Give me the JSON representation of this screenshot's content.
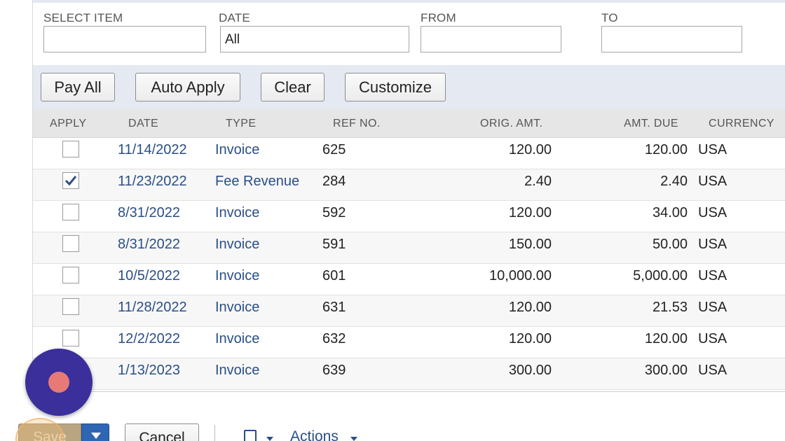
{
  "filters": {
    "select_item_label": "SELECT ITEM",
    "select_item_value": "",
    "date_label": "DATE",
    "date_value": "All",
    "from_label": "FROM",
    "from_value": "",
    "to_label": "TO",
    "to_value": ""
  },
  "buttons": {
    "pay_all": "Pay All",
    "auto_apply": "Auto Apply",
    "clear": "Clear",
    "customize": "Customize"
  },
  "columns": [
    "APPLY",
    "DATE",
    "TYPE",
    "REF NO.",
    "ORIG. AMT.",
    "AMT. DUE",
    "CURRENCY"
  ],
  "rows": [
    {
      "checked": false,
      "date": "11/14/2022",
      "type": "Invoice",
      "ref": "625",
      "orig": "120.00",
      "due": "120.00",
      "currency": "USA"
    },
    {
      "checked": true,
      "date": "11/23/2022",
      "type": "Fee Revenue",
      "ref": "284",
      "orig": "2.40",
      "due": "2.40",
      "currency": "USA"
    },
    {
      "checked": false,
      "date": "8/31/2022",
      "type": "Invoice",
      "ref": "592",
      "orig": "120.00",
      "due": "34.00",
      "currency": "USA"
    },
    {
      "checked": false,
      "date": "8/31/2022",
      "type": "Invoice",
      "ref": "591",
      "orig": "150.00",
      "due": "50.00",
      "currency": "USA"
    },
    {
      "checked": false,
      "date": "10/5/2022",
      "type": "Invoice",
      "ref": "601",
      "orig": "10,000.00",
      "due": "5,000.00",
      "currency": "USA"
    },
    {
      "checked": false,
      "date": "11/28/2022",
      "type": "Invoice",
      "ref": "631",
      "orig": "120.00",
      "due": "21.53",
      "currency": "USA"
    },
    {
      "checked": false,
      "date": "12/2/2022",
      "type": "Invoice",
      "ref": "632",
      "orig": "120.00",
      "due": "120.00",
      "currency": "USA"
    },
    {
      "checked": false,
      "date": "1/13/2023",
      "type": "Invoice",
      "ref": "639",
      "orig": "300.00",
      "due": "300.00",
      "currency": "USA"
    }
  ],
  "footer": {
    "save": "Save",
    "cancel": "Cancel",
    "actions": "Actions"
  },
  "icons": {
    "record": "record-icon",
    "document": "document-icon",
    "save_menu": "chevron-down-icon"
  },
  "colors": {
    "link": "#2a4f86",
    "record_button": "#3a2f9b",
    "save_primary": "#2f66b3"
  }
}
